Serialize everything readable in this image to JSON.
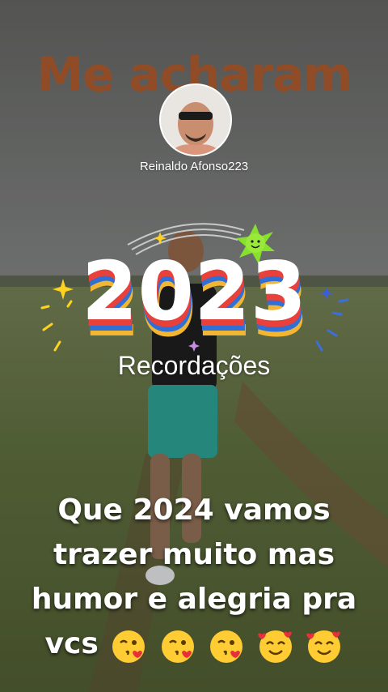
{
  "video": {
    "overlay_title": "Me acharam",
    "profile": {
      "username": "Reinaldo Afonso223"
    },
    "recap": {
      "year": "2023",
      "label": "Recordações"
    },
    "caption": {
      "lines": [
        "Que 2024 vamos",
        "trazer muito mas",
        "humor e alegria pra",
        "vcs"
      ],
      "emojis": [
        "kissing-face-blowing-heart",
        "kissing-face-blowing-heart",
        "kissing-face-blowing-heart",
        "smiling-face-with-hearts",
        "smiling-face-with-hearts"
      ]
    }
  },
  "colors": {
    "title": "#9a4a1e",
    "year_fill": "#ffffff",
    "year_stripes": [
      "#e8403a",
      "#2f6fd6",
      "#f2b632"
    ],
    "sparkle": "#ffd21f",
    "sun": "#86e02e"
  }
}
